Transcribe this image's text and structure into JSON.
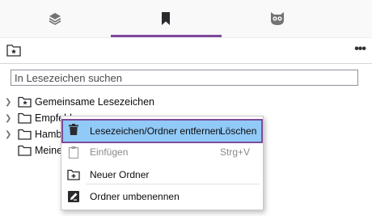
{
  "tabs": [
    {
      "icon": "layers-icon"
    },
    {
      "icon": "bookmark-icon"
    },
    {
      "icon": "owl-icon"
    }
  ],
  "colors": {
    "accent": "#7d4b99",
    "highlight": "#91c9f7"
  },
  "toolbar": {
    "more_label": "•••"
  },
  "search": {
    "placeholder": "In Lesezeichen suchen"
  },
  "tree": [
    {
      "label": "Gemeinsame Lesezeichen"
    },
    {
      "label": "Empfehlungen"
    },
    {
      "label": "Hamburg"
    },
    {
      "label": "Meine"
    }
  ],
  "context_menu": {
    "items": [
      {
        "label": "Lesezeichen/Ordner entfernen",
        "shortcut": "Löschen",
        "icon": "trash-icon"
      },
      {
        "label": "Einfügen",
        "shortcut": "Strg+V",
        "icon": "paste-icon"
      },
      {
        "label": "Neuer Ordner",
        "icon": "new-folder-icon"
      },
      {
        "label": "Ordner umbenennen",
        "icon": "rename-icon"
      }
    ]
  }
}
